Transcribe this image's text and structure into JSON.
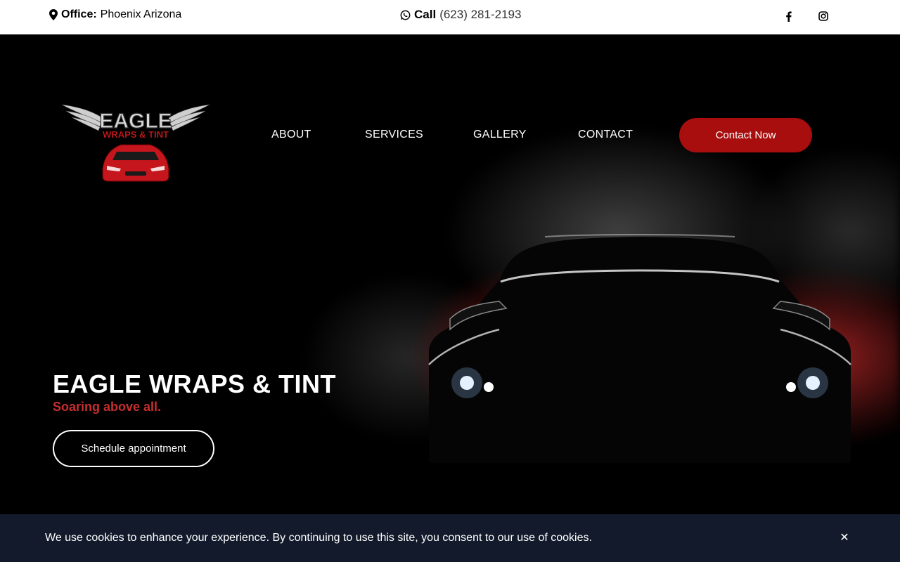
{
  "topbar": {
    "office_label": "Office:",
    "office_value": "Phoenix Arizona",
    "call_label": "Call",
    "phone": "(623) 281-2193",
    "icons": [
      "map-pin-icon",
      "whatsapp-icon",
      "facebook-icon",
      "instagram-icon"
    ]
  },
  "nav": {
    "about": "ABOUT",
    "services": "SERVICES",
    "gallery": "GALLERY",
    "contact": "CONTACT",
    "cta": "Contact Now"
  },
  "hero": {
    "title": "EAGLE WRAPS & TINT",
    "subtitle": "Soaring above all.",
    "button": "Schedule appointment"
  },
  "logo": {
    "line1": "EAGLE",
    "line2": "WRAPS & TINT"
  },
  "cookie": {
    "message": "We use cookies to enhance your experience. By continuing to use this site, you consent to our use of cookies.",
    "close": "✕"
  },
  "colors": {
    "accent_red": "#a80e0e",
    "subtitle_red": "#c62f2f",
    "cookie_bg": "#121a2b",
    "topbar_bg": "#ffffff"
  }
}
